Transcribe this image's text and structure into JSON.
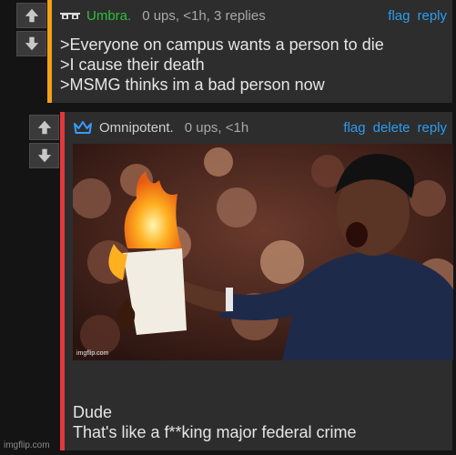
{
  "comments": [
    {
      "username": "Umbra.",
      "meta": "0 ups, <1h, 3 replies",
      "actions": [
        "flag",
        "reply"
      ],
      "body": ">Everyone on campus wants a person to die\n>I cause their death\n>MSMG thinks im a bad person now",
      "user_color": "#2fbf3a",
      "bar_color": "#f4a016",
      "avatar_icon": "pixel-glasses-icon"
    },
    {
      "username": "Omnipotent.",
      "meta": "0 ups, <1h",
      "actions": [
        "flag",
        "delete",
        "reply"
      ],
      "image_watermark": "imgflip.com",
      "body": "Dude\nThat's like a f**king major federal crime",
      "user_color": "#cfcfcf",
      "bar_color": "#e0383e",
      "avatar_icon": "crown-icon"
    }
  ],
  "site_watermark": "imgflip.com",
  "link_color": "#2c9cf0"
}
